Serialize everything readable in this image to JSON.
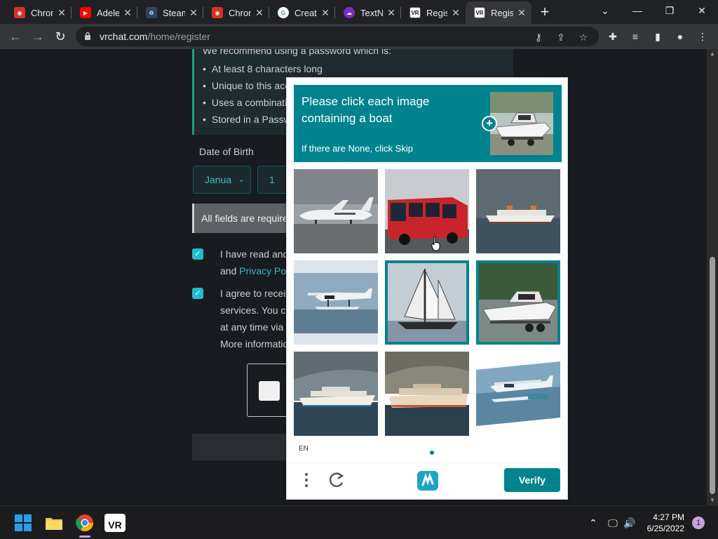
{
  "browser": {
    "tabs": [
      {
        "title": "Chrom",
        "icon": "chrome-icon",
        "color": "#d93025"
      },
      {
        "title": "Adele",
        "icon": "youtube-icon",
        "color": "#ff0000"
      },
      {
        "title": "Steam",
        "icon": "steam-icon",
        "color": "#1b2838"
      },
      {
        "title": "Chrom",
        "icon": "chrome-icon",
        "color": "#d93025"
      },
      {
        "title": "Creat",
        "icon": "google-icon",
        "color": "#4285f4"
      },
      {
        "title": "TextN",
        "icon": "textnow-icon",
        "color": "#7b2cbf"
      },
      {
        "title": "Regis",
        "icon": "vrchat-icon",
        "color": "#111111"
      },
      {
        "title": "Regis",
        "icon": "vrchat-icon",
        "color": "#111111"
      }
    ],
    "url_host": "vrchat.com",
    "url_path": "/home/register"
  },
  "page": {
    "password_lead": "We recommend using a password which is:",
    "password_rules": [
      "At least 8 characters long",
      "Unique to this acco",
      "Uses a combinatio",
      "Stored in a Passw"
    ],
    "dob_label": "Date of Birth",
    "month_value": "Janua",
    "day_value": "1",
    "required_notice": "All fields are require",
    "terms_line1": "I have read and",
    "terms_line2_prefix": "and",
    "terms_link": "Privacy Poli",
    "offers_line1": "I agree to receiv",
    "offers_line2": "services. You ca",
    "offers_line3": "at any time via t",
    "offers_line4": "More informatio"
  },
  "captcha": {
    "prompt": "Please click each image containing a boat",
    "skip_hint": "If there are None, click Skip",
    "language": "EN",
    "verify_label": "Verify",
    "tiles": [
      {
        "subject": "airplane",
        "selected": false
      },
      {
        "subject": "bus",
        "selected": false
      },
      {
        "subject": "cruise ship",
        "selected": false
      },
      {
        "subject": "seaplane",
        "selected": false
      },
      {
        "subject": "sailboat",
        "selected": true
      },
      {
        "subject": "motorboat on trailer",
        "selected": true
      },
      {
        "subject": "cruise ship",
        "selected": false
      },
      {
        "subject": "cruise ship",
        "selected": false
      },
      {
        "subject": "seaplane",
        "selected": false
      }
    ]
  },
  "taskbar": {
    "time": "4:27 PM",
    "date": "6/25/2022",
    "notification_count": "1"
  },
  "colors": {
    "accent": "#00838f",
    "link": "#3fb8c0",
    "checkbox": "#22bcd0"
  }
}
